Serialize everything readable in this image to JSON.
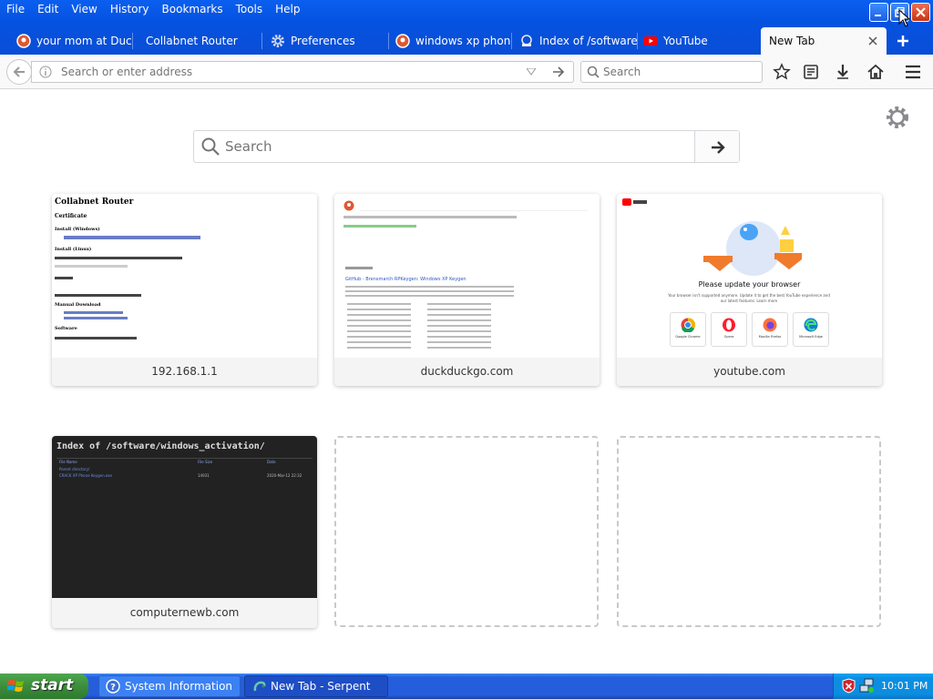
{
  "menu": [
    "File",
    "Edit",
    "View",
    "History",
    "Bookmarks",
    "Tools",
    "Help"
  ],
  "tabs": [
    {
      "label": "your mom at DuckD"
    },
    {
      "label": "Collabnet Router"
    },
    {
      "label": "Preferences"
    },
    {
      "label": "windows xp phone"
    },
    {
      "label": "Index of /software"
    },
    {
      "label": "YouTube"
    },
    {
      "label": "New Tab",
      "active": true
    }
  ],
  "navbar": {
    "url_placeholder": "Search or enter address",
    "search_placeholder": "Search"
  },
  "newtab": {
    "search_placeholder": "Search",
    "sites": [
      {
        "label": "192.168.1.1",
        "thumb_title": "Collabnet Router"
      },
      {
        "label": "duckduckgo.com",
        "thumb_title": "GitHub - Brensmarch RPKeygen: Windows XP Keygen"
      },
      {
        "label": "youtube.com",
        "thumb_title": "Please update your browser"
      },
      {
        "label": "computernewb.com",
        "thumb_title": "Index of /software/windows_activation/"
      }
    ],
    "collabnet_thumb": {
      "sections": [
        "Certificate",
        "Install (Windows)",
        "Install (Linux)",
        "Manual Download",
        "Software"
      ]
    },
    "youtube_thumb": {
      "text": "Your browser isn't supported anymore. Update it to get the best YouTube experience and our latest features. Learn more",
      "browsers": [
        "Google Chrome",
        "Opera",
        "Mozilla Firefox",
        "Microsoft Edge"
      ]
    },
    "index_thumb": {
      "headers": [
        "File Name",
        "File Size",
        "Date"
      ],
      "row_parent": "Parent directory/",
      "row_file": "CRACK XP Phone Keygen.exe",
      "row_size": "14931",
      "row_date": "2020-Mar-12 22:32"
    }
  },
  "taskbar": {
    "start": "start",
    "tasks": [
      "System Information",
      "New Tab - Serpent"
    ],
    "clock": "10:01 PM"
  }
}
